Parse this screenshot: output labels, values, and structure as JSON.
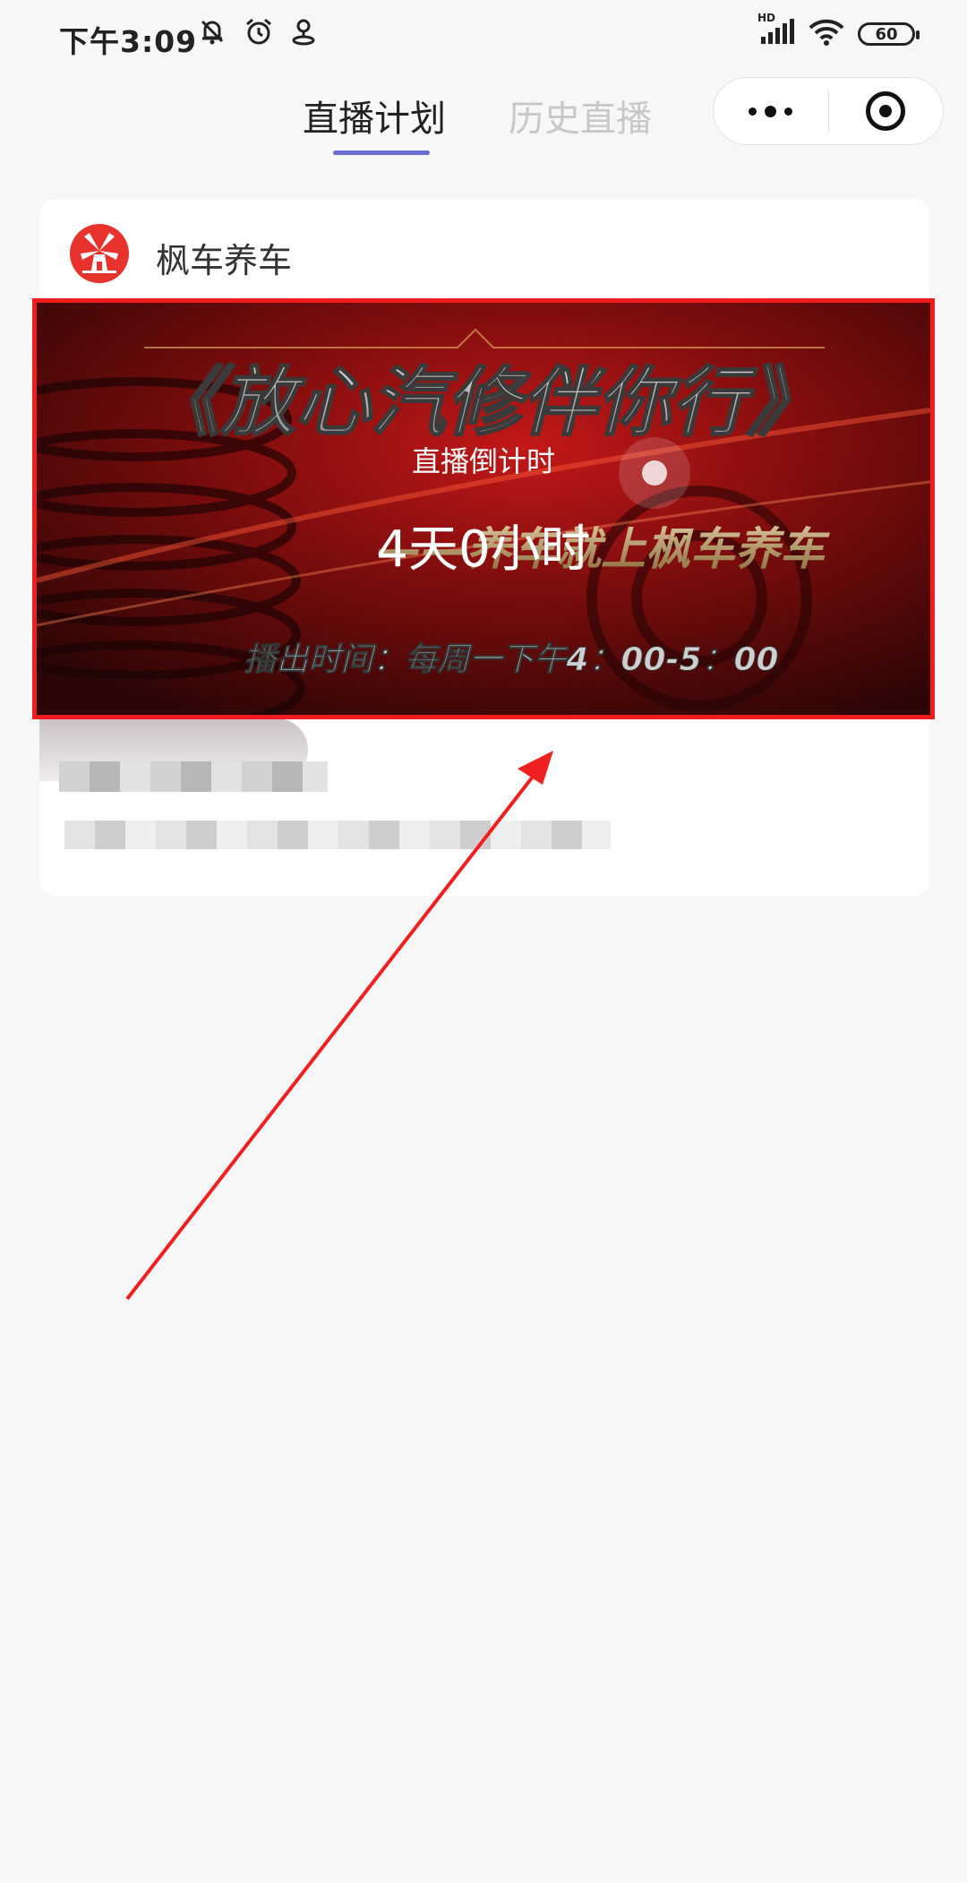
{
  "status_bar": {
    "time": "下午3:09",
    "network_label": "HD",
    "battery": "60"
  },
  "header": {
    "tabs": [
      {
        "label": "直播计划",
        "active": true
      },
      {
        "label": "历史直播",
        "active": false
      }
    ],
    "accent_color": "#6b6ed0"
  },
  "card": {
    "shop_name": "枫车养车",
    "banner": {
      "title": "《放心汽修伴你行》",
      "slogan": "——养车就上枫车养车",
      "schedule": "播出时间：每周一下午4：00-5：00",
      "countdown_label": "直播倒计时",
      "countdown_value": "4天0小时"
    }
  },
  "colors": {
    "highlight_border": "#ef1d1d",
    "arrow": "#f02020",
    "logo": "#e8322e"
  }
}
